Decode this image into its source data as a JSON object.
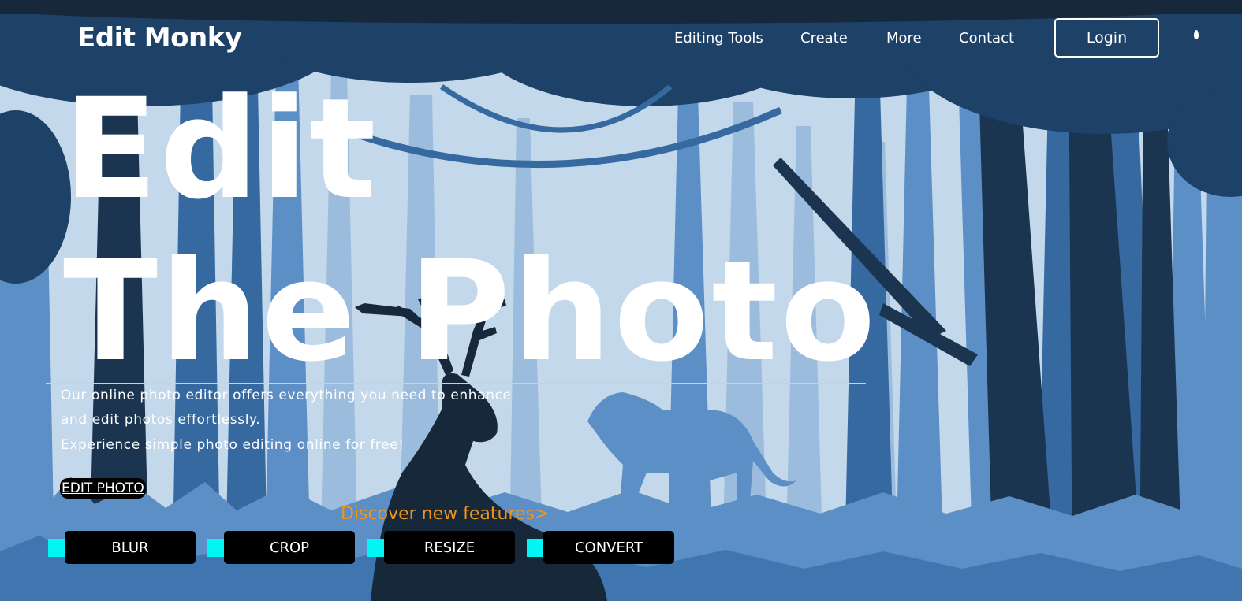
{
  "header": {
    "brand": "Edit Monky",
    "nav": [
      "Editing Tools",
      "Create",
      "More",
      "Contact"
    ],
    "login_label": "Login"
  },
  "hero": {
    "title_line1": "Edit",
    "title_line2": "The Photo",
    "description": [
      "Our online photo editor offers everything you need to enhance",
      "and edit photos effortlessly.",
      "Experience simple photo editing online for free!"
    ],
    "cta_label": "EDIT PHOTO"
  },
  "features": {
    "heading": "Discover new features>",
    "items": [
      "BLUR",
      "CROP",
      "RESIZE",
      "CONVERT"
    ]
  },
  "colors": {
    "sky": "#c3d8ea",
    "far_trees": "#8fb1d6",
    "mid_trees": "#5287bf",
    "near_trees": "#2f6499",
    "dark": "#17283a",
    "accent_orange": "#f0951c",
    "accent_cyan": "#00f5f5"
  }
}
